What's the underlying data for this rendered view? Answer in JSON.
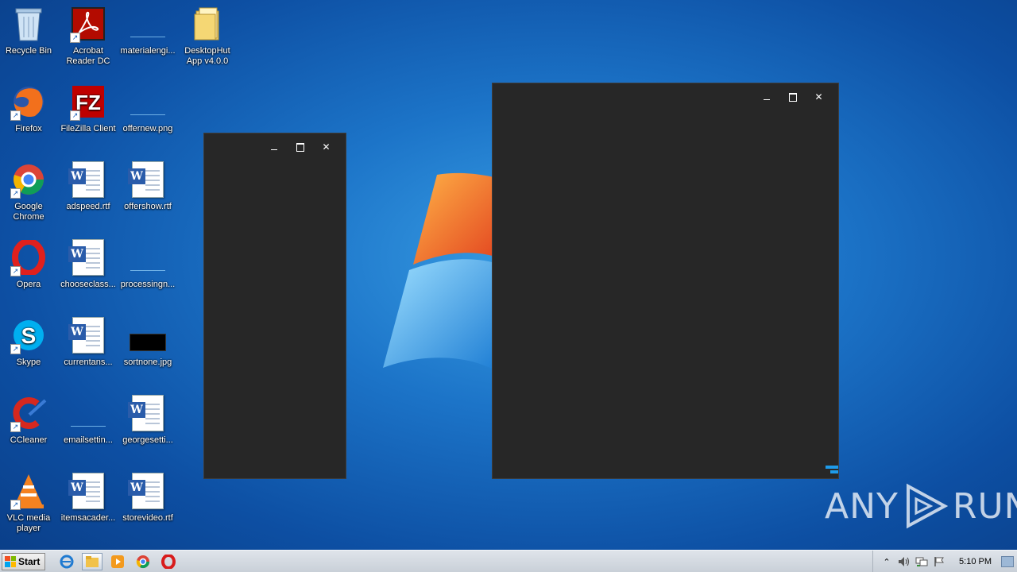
{
  "desktop": {
    "icons": [
      {
        "label": "Recycle Bin",
        "icon": "recycle-bin-icon",
        "shortcut": false
      },
      {
        "label": "Acrobat Reader DC",
        "icon": "acrobat-icon",
        "shortcut": true
      },
      {
        "label": "materialengi...",
        "icon": "image-file-icon",
        "shortcut": false
      },
      {
        "label": "DesktopHut App v4.0.0",
        "icon": "folder-icon",
        "shortcut": false
      },
      {
        "label": "Firefox",
        "icon": "firefox-icon",
        "shortcut": true
      },
      {
        "label": "FileZilla Client",
        "icon": "filezilla-icon",
        "shortcut": true
      },
      {
        "label": "offernew.png",
        "icon": "image-file-icon",
        "shortcut": false
      },
      {
        "label": "Google Chrome",
        "icon": "chrome-icon",
        "shortcut": true
      },
      {
        "label": "adspeed.rtf",
        "icon": "word-doc-icon",
        "shortcut": false
      },
      {
        "label": "offershow.rtf",
        "icon": "word-doc-icon",
        "shortcut": false
      },
      {
        "label": "Opera",
        "icon": "opera-icon",
        "shortcut": true
      },
      {
        "label": "chooseclass...",
        "icon": "word-doc-icon",
        "shortcut": false
      },
      {
        "label": "processingn...",
        "icon": "image-file-icon",
        "shortcut": false
      },
      {
        "label": "Skype",
        "icon": "skype-icon",
        "shortcut": true
      },
      {
        "label": "currentans...",
        "icon": "word-doc-icon",
        "shortcut": false
      },
      {
        "label": "sortnone.jpg",
        "icon": "image-file-icon",
        "shortcut": false
      },
      {
        "label": "CCleaner",
        "icon": "ccleaner-icon",
        "shortcut": true
      },
      {
        "label": "emailsettin...",
        "icon": "image-file-icon",
        "shortcut": false
      },
      {
        "label": "georgesetti...",
        "icon": "word-doc-icon",
        "shortcut": false
      },
      {
        "label": "VLC media player",
        "icon": "vlc-icon",
        "shortcut": true
      },
      {
        "label": "itemsacader...",
        "icon": "word-doc-icon",
        "shortcut": false
      },
      {
        "label": "storevideo.rtf",
        "icon": "word-doc-icon",
        "shortcut": false
      }
    ]
  },
  "windows": {
    "small": {
      "min_glyph": "",
      "max_glyph": "",
      "close_glyph": "✕"
    },
    "large": {
      "min_glyph": "",
      "max_glyph": "",
      "close_glyph": "✕"
    }
  },
  "watermark": {
    "text_left": "ANY",
    "text_right": "RUN"
  },
  "taskbar": {
    "start_label": "Start",
    "pinned": [
      "internet-explorer-icon",
      "explorer-folder-icon",
      "media-player-icon",
      "chrome-icon",
      "opera-icon"
    ],
    "tray": {
      "expand_glyph": "⌃",
      "clock": "5:10 PM"
    }
  }
}
